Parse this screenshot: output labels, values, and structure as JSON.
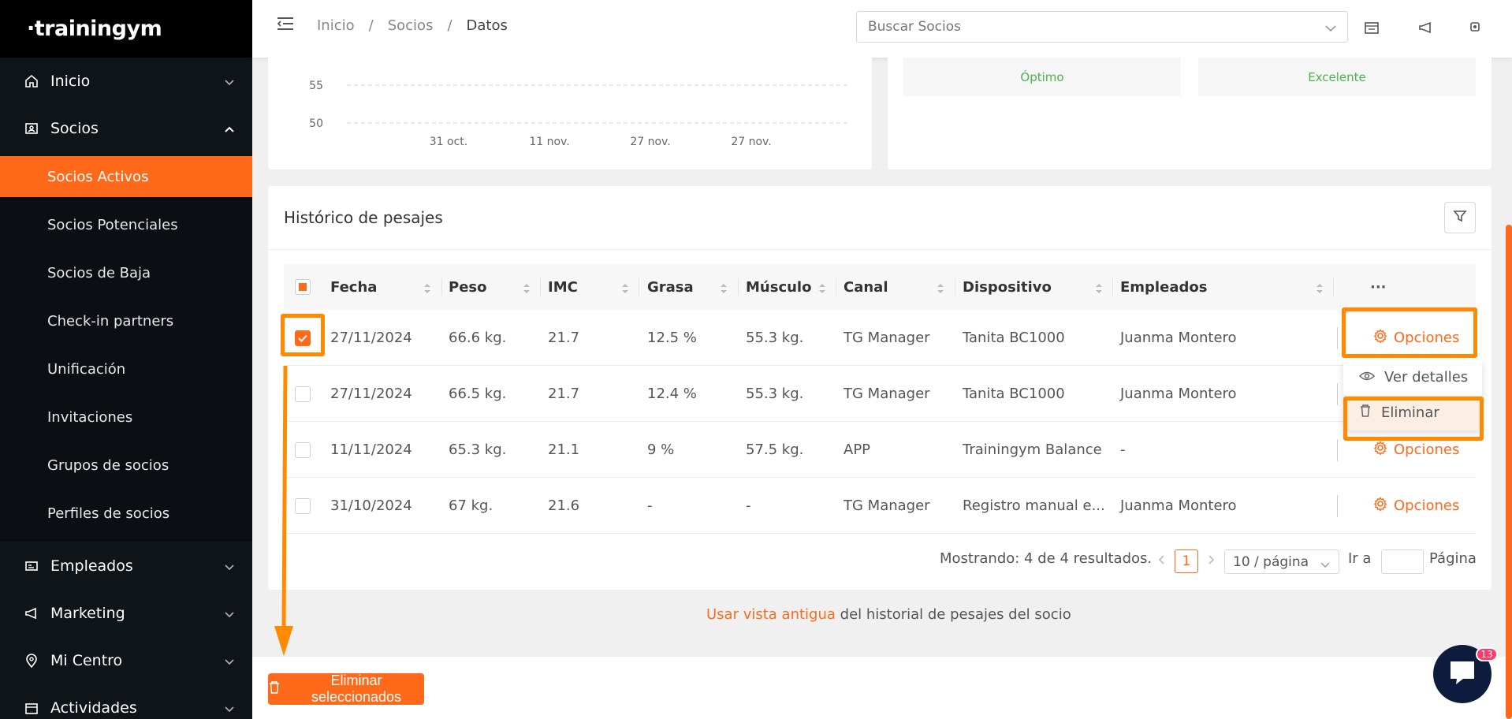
{
  "sidebar": {
    "logo": "·trainingym",
    "items": [
      {
        "label": "Inicio"
      },
      {
        "label": "Socios"
      },
      {
        "label": "Empleados"
      },
      {
        "label": "Marketing"
      },
      {
        "label": "Mi Centro"
      },
      {
        "label": "Actividades"
      }
    ],
    "socios_sub": [
      {
        "label": "Socios Activos"
      },
      {
        "label": "Socios Potenciales"
      },
      {
        "label": "Socios de Baja"
      },
      {
        "label": "Check-in partners"
      },
      {
        "label": "Unificación"
      },
      {
        "label": "Invitaciones"
      },
      {
        "label": "Grupos de socios"
      },
      {
        "label": "Perfiles de socios"
      }
    ]
  },
  "header": {
    "breadcrumb": [
      "Inicio",
      "/",
      "Socios",
      "/",
      "Datos"
    ],
    "search_placeholder": "Buscar Socios"
  },
  "chart_data": {
    "type": "line",
    "categories": [
      "31 oct.",
      "11 nov.",
      "27 nov.",
      "27 nov."
    ],
    "y_ticks": [
      "55",
      "50"
    ],
    "series": []
  },
  "stats": {
    "left_status": "Óptimo",
    "right_status": "Excelente"
  },
  "table": {
    "title": "Histórico de pesajes",
    "columns": [
      "Fecha",
      "Peso",
      "IMC",
      "Grasa",
      "Músculo",
      "Canal",
      "Dispositivo",
      "Empleados"
    ],
    "more_label": "···",
    "rows": [
      {
        "fecha": "27/11/2024",
        "peso": "66.6 kg.",
        "imc": "21.7",
        "grasa": "12.5 %",
        "musculo": "55.3 kg.",
        "canal": "TG Manager",
        "dispositivo": "Tanita BC1000",
        "empleados": "Juanma Montero",
        "checked": true
      },
      {
        "fecha": "27/11/2024",
        "peso": "66.5 kg.",
        "imc": "21.7",
        "grasa": "12.4 %",
        "musculo": "55.3 kg.",
        "canal": "TG Manager",
        "dispositivo": "Tanita BC1000",
        "empleados": "Juanma Montero",
        "checked": false
      },
      {
        "fecha": "11/11/2024",
        "peso": "65.3 kg.",
        "imc": "21.1",
        "grasa": "9 %",
        "musculo": "57.5 kg.",
        "canal": "APP",
        "dispositivo": "Trainingym Balance",
        "empleados": "-",
        "checked": false
      },
      {
        "fecha": "31/10/2024",
        "peso": "67 kg.",
        "imc": "21.6",
        "grasa": "-",
        "musculo": "-",
        "canal": "TG Manager",
        "dispositivo": "Registro manual e...",
        "empleados": "Juanma Montero",
        "checked": false
      }
    ],
    "options_label": "Opciones",
    "dropdown": {
      "view": "Ver detalles",
      "delete": "Eliminar"
    }
  },
  "pagination": {
    "summary": "Mostrando: 4 de 4 resultados.",
    "current_page": "1",
    "per_page": "10 / página",
    "goto_label": "Ir a",
    "page_label": "Página"
  },
  "footer": {
    "link_text": "Usar vista antigua",
    "rest_text": " del historial de pesajes del socio"
  },
  "bottom": {
    "delete_selected": "Eliminar seleccionados"
  },
  "chat": {
    "badge": "13"
  },
  "colors": {
    "accent": "#ff6a1a",
    "sidebar": "#0f1419",
    "success": "#4ab34a",
    "annotation": "#ff8a00"
  }
}
